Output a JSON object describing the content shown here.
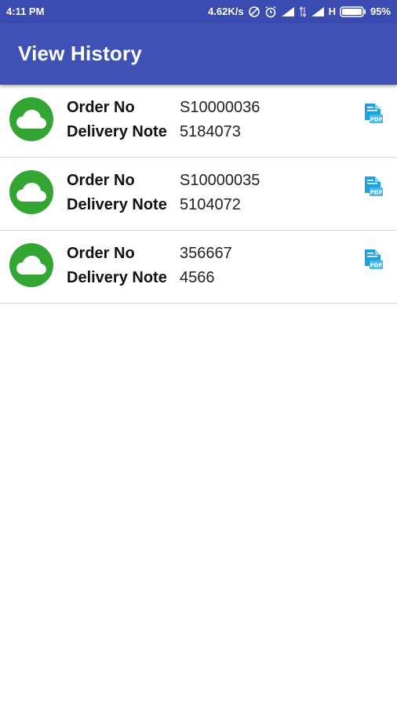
{
  "status_bar": {
    "time": "4:11 PM",
    "speed": "4.62K/s",
    "network_type": "H",
    "battery": "95%",
    "icons": [
      "data-saver-icon",
      "alarm-icon",
      "signal-icon",
      "data-arrows-icon",
      "signal-icon",
      "battery-icon"
    ]
  },
  "app_bar": {
    "title": "View History",
    "color": "#3f51b5"
  },
  "history": {
    "order_label": "Order No",
    "delivery_label": "Delivery Note",
    "avatar_icon": "cloud-icon",
    "action_icon": "pdf-icon",
    "avatar_color": "#33a532",
    "action_color": "#1aa3e0",
    "items": [
      {
        "order_no": "S10000036",
        "delivery_note": "5184073"
      },
      {
        "order_no": "S10000035",
        "delivery_note": "5104072"
      },
      {
        "order_no": "356667",
        "delivery_note": "4566"
      }
    ]
  }
}
